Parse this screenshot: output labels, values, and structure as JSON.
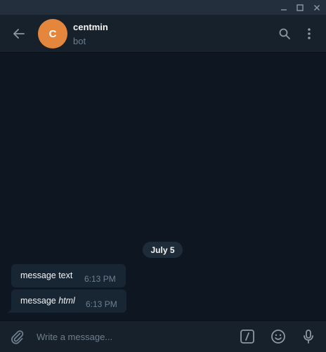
{
  "window": {
    "controls": [
      "minimize-icon",
      "maximize-icon",
      "close-icon"
    ]
  },
  "header": {
    "avatar_letter": "C",
    "avatar_color": "#e4873d",
    "name": "centmin",
    "status": "bot",
    "icons": [
      "back-arrow-icon",
      "search-icon",
      "more-vertical-icon"
    ]
  },
  "chat": {
    "date_separator": "July 5",
    "messages": [
      {
        "text": "message text",
        "time": "6:13 PM"
      },
      {
        "text_plain": "message ",
        "text_italic": "html",
        "time": "6:13 PM"
      }
    ]
  },
  "compose": {
    "placeholder": "Write a message...",
    "icons": [
      "attach-icon",
      "bot-command-icon",
      "emoji-icon",
      "microphone-icon"
    ]
  },
  "colors": {
    "background": "#0e1621",
    "panel": "#17212b",
    "bubble": "#182533",
    "muted_text": "#6d7f8f",
    "text": "#f5f5f5"
  }
}
